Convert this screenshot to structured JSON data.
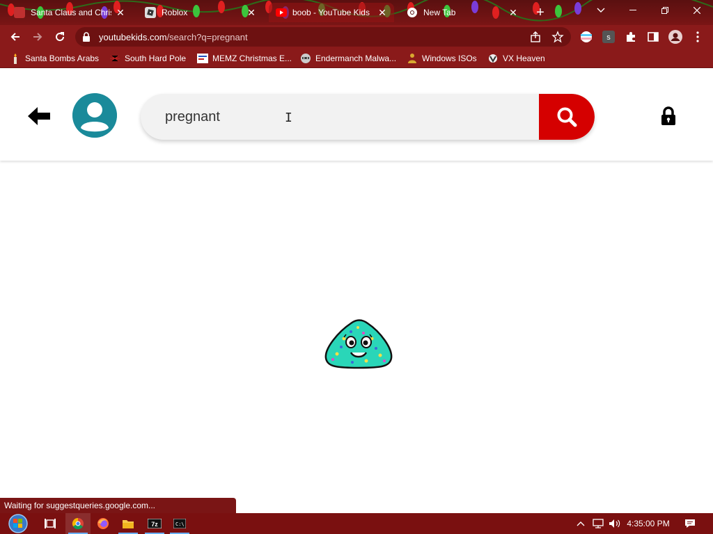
{
  "browser": {
    "tabs": [
      {
        "title": "Santa Claus and Christ",
        "favicon": "doc-icon",
        "active": false
      },
      {
        "title": "Roblox",
        "favicon": "roblox-icon",
        "active": false
      },
      {
        "title": "boob - YouTube Kids",
        "favicon": "youtube-icon",
        "active": true
      },
      {
        "title": "New Tab",
        "favicon": "chrome-icon",
        "active": false
      }
    ],
    "new_tab_label": "+",
    "close_glyph": "✕",
    "url_host": "youtubekids.com",
    "url_path": "/search?q=pregnant",
    "bookmarks": [
      {
        "label": "Santa Bombs Arabs",
        "icon": "candle-icon"
      },
      {
        "label": "South Hard Pole",
        "icon": "spider-icon"
      },
      {
        "label": "MEMZ Christmas E...",
        "icon": "memz-icon"
      },
      {
        "label": "Endermanch Malwa...",
        "icon": "raccoon-icon"
      },
      {
        "label": "Windows ISOs",
        "icon": "buddha-icon"
      },
      {
        "label": "VX Heaven",
        "icon": "vx-icon"
      }
    ],
    "status_text": "Waiting for suggestqueries.google.com..."
  },
  "page": {
    "search_value": "pregnant",
    "colors": {
      "search_button": "#d50000",
      "avatar": "#1a8a9a",
      "mascot": "#2ad6b8"
    }
  },
  "taskbar": {
    "clock": "4:35:00 PM",
    "apps": [
      "task-view-icon",
      "chrome-icon",
      "firefox-icon",
      "file-explorer-icon",
      "7zip-icon",
      "cmd-icon"
    ]
  }
}
